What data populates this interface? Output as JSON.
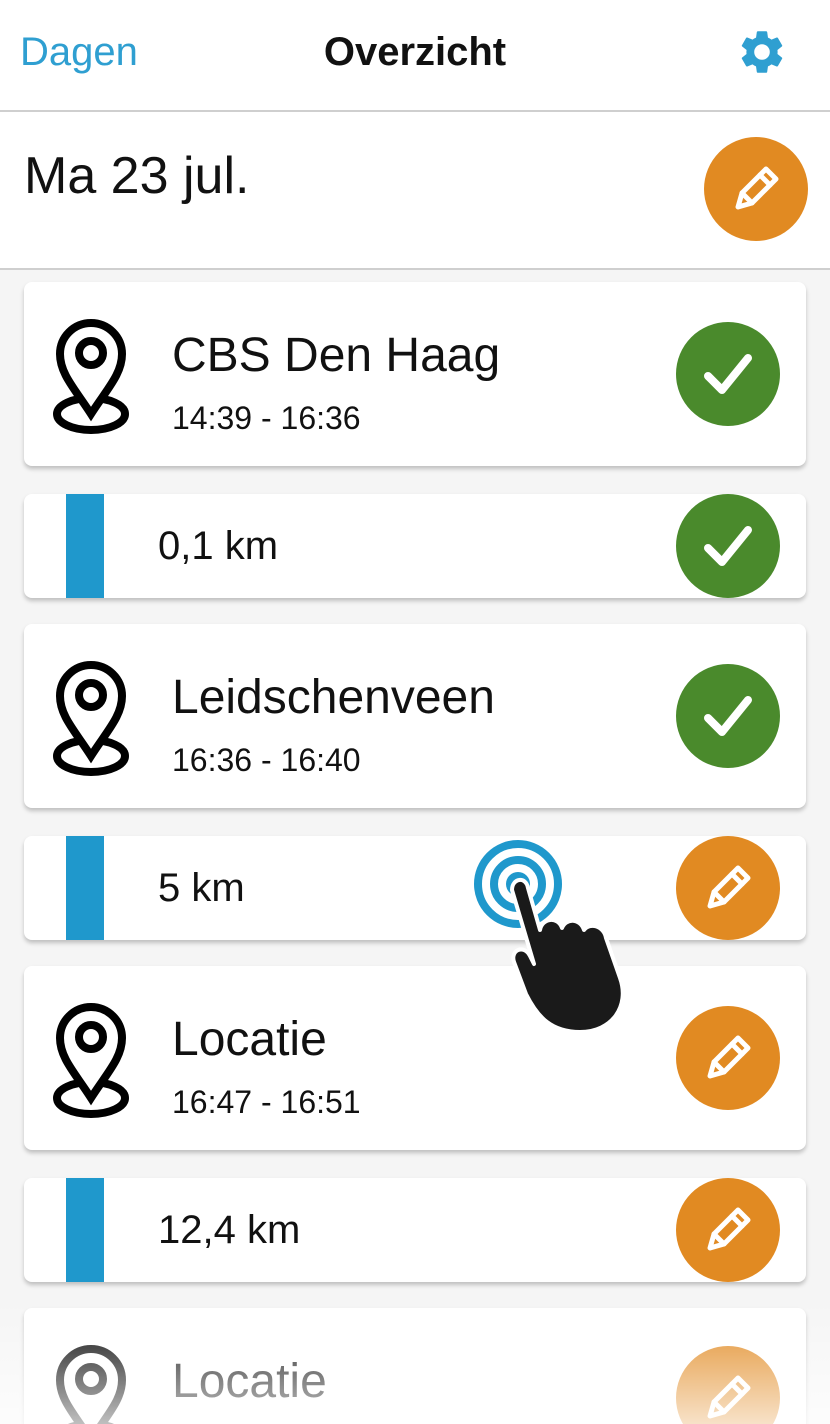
{
  "nav": {
    "back_label": "Dagen",
    "title": "Overzicht",
    "settings_icon": "gear-icon"
  },
  "day": {
    "title": "Ma 23 jul.",
    "edit_icon": "pencil-icon"
  },
  "items": [
    {
      "type": "location",
      "name": "CBS Den Haag",
      "time": "14:39 - 16:36",
      "status": "confirmed"
    },
    {
      "type": "trip",
      "distance": "0,1 km",
      "status": "confirmed"
    },
    {
      "type": "location",
      "name": "Leidschenveen",
      "time": "16:36 - 16:40",
      "status": "confirmed"
    },
    {
      "type": "trip",
      "distance": "5 km",
      "status": "edit"
    },
    {
      "type": "location",
      "name": "Locatie",
      "time": "16:47 - 16:51",
      "status": "edit"
    },
    {
      "type": "trip",
      "distance": "12,4 km",
      "status": "edit"
    },
    {
      "type": "location",
      "name": "Locatie",
      "time": "",
      "status": "edit"
    }
  ],
  "colors": {
    "accent": "#2f9fd1",
    "confirmed": "#4a8a2c",
    "edit": "#e18a22",
    "trip_bar": "#1f98cc"
  }
}
